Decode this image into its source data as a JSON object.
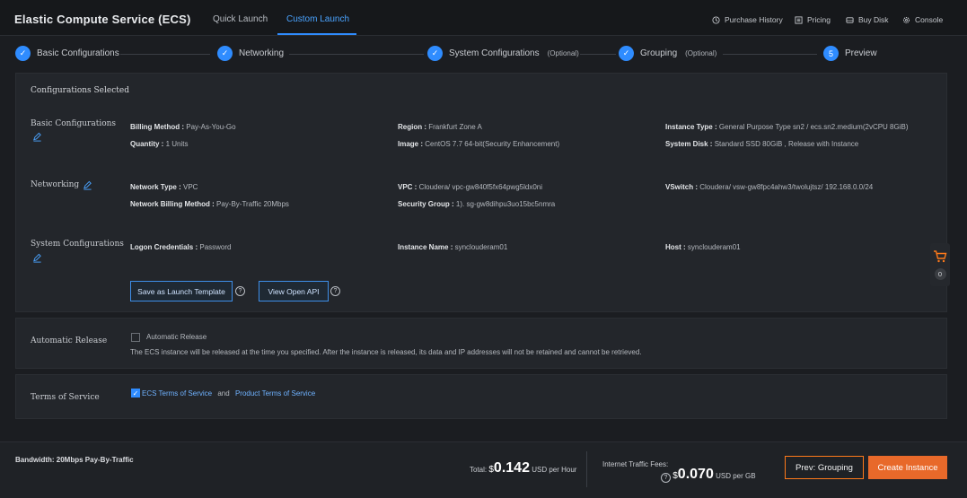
{
  "header": {
    "app_title": "Elastic Compute Service (ECS)",
    "tabs": [
      {
        "label": "Quick Launch",
        "active": false
      },
      {
        "label": "Custom Launch",
        "active": true
      }
    ],
    "links": [
      {
        "label": "Purchase History",
        "icon": "clock-icon"
      },
      {
        "label": "Pricing",
        "icon": "list-icon"
      },
      {
        "label": "Buy Disk",
        "icon": "disk-icon"
      },
      {
        "label": "Console",
        "icon": "gear-icon"
      }
    ]
  },
  "steps": [
    {
      "label": "Basic Configurations",
      "optional": "",
      "marker": "check"
    },
    {
      "label": "Networking",
      "optional": "",
      "marker": "check"
    },
    {
      "label": "System Configurations",
      "optional": "(Optional)",
      "marker": "check"
    },
    {
      "label": "Grouping",
      "optional": "(Optional)",
      "marker": "check"
    },
    {
      "label": "Preview",
      "optional": "",
      "marker": "5"
    }
  ],
  "summary": {
    "title": "Configurations Selected",
    "basic": {
      "label": "Basic Configurations",
      "billing_method_key": "Billing Method :",
      "billing_method_val": "Pay-As-You-Go",
      "quantity_key": "Quantity :",
      "quantity_val": "1 Units",
      "region_key": "Region :",
      "region_val": "Frankfurt Zone A",
      "image_key": "Image :",
      "image_val": "CentOS 7.7 64-bit(Security Enhancement)",
      "instance_type_key": "Instance Type :",
      "instance_type_val": "General Purpose Type sn2 / ecs.sn2.medium(2vCPU 8GiB)",
      "system_disk_key": "System Disk :",
      "system_disk_val": "Standard SSD 80GiB , Release with Instance"
    },
    "networking": {
      "label": "Networking",
      "network_type_key": "Network Type :",
      "network_type_val": "VPC",
      "billing_key": "Network Billing Method :",
      "billing_val": "Pay-By-Traffic 20Mbps",
      "vpc_key": "VPC :",
      "vpc_val": "Cloudera/ vpc-gw840f5fx64pwg5ldx0ni",
      "security_group_key": "Security Group :",
      "security_group_val": "1). sg-gw8dihpu3uo15bc5nmra",
      "vswitch_key": "VSwitch :",
      "vswitch_val": "Cloudera/ vsw-gw8fpc4ahw3/twolujtsz/ 192.168.0.0/24"
    },
    "system": {
      "label": "System Configurations",
      "logon_key": "Logon Credentials :",
      "logon_val": "Password",
      "instance_name_key": "Instance Name :",
      "instance_name_val": "synclouderam01",
      "host_key": "Host :",
      "host_val": "synclouderam01"
    },
    "save_template_label": "Save as Launch Template",
    "view_api_label": "View Open API",
    "help_glyph": "?"
  },
  "auto_release": {
    "label": "Automatic Release",
    "checkbox_label": "Automatic Release",
    "checked": false,
    "description": "The ECS instance will be released at the time you specified. After the instance is released, its data and IP addresses will not be retained and cannot be retrieved."
  },
  "terms": {
    "label": "Terms of Service",
    "checked": true,
    "ecs_terms": "ECS Terms of Service",
    "and": "and",
    "product_terms": "Product Terms of Service"
  },
  "cart": {
    "count": "0"
  },
  "footer": {
    "bandwidth": "Bandwidth: 20Mbps Pay-By-Traffic",
    "total_label": "Total:",
    "currency": "$",
    "total_value": "0.142",
    "total_unit": "USD per Hour",
    "traffic_label": "Internet Traffic Fees:",
    "traffic_value": "0.070",
    "traffic_unit": "USD per GB",
    "prev_label": "Prev: Grouping",
    "create_label": "Create Instance"
  },
  "colors": {
    "accent": "#2f8cff",
    "primary_button": "#e8692a",
    "background": "#1b1d21"
  }
}
